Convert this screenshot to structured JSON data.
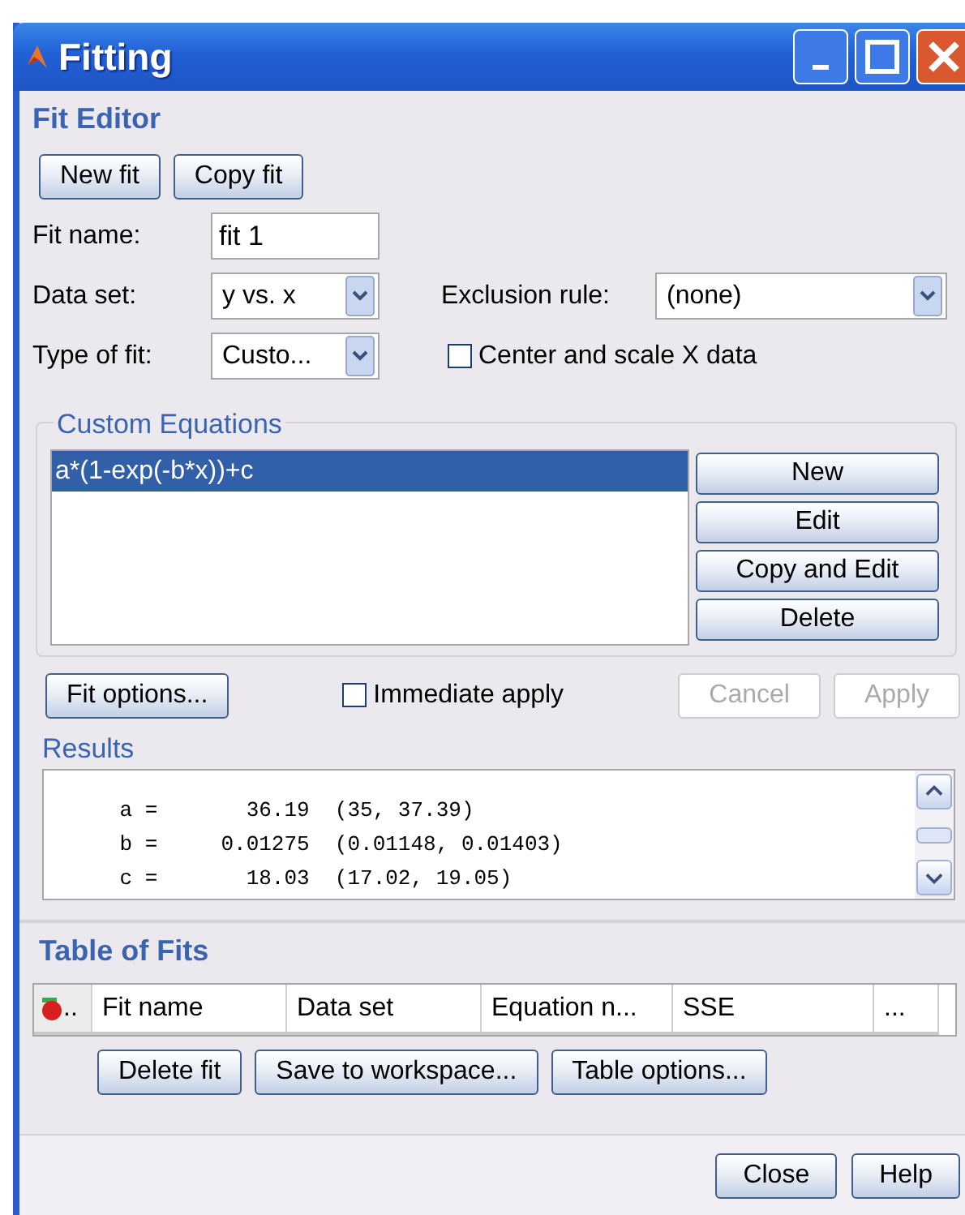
{
  "window": {
    "title": "Fitting"
  },
  "fit_editor": {
    "title": "Fit Editor",
    "top_buttons": [
      {
        "label": "New fit",
        "disabled": false
      },
      {
        "label": "Copy fit",
        "disabled": false
      }
    ],
    "fit_name": {
      "label": "Fit name:",
      "value": "fit 1"
    },
    "data_set": {
      "label": "Data set:",
      "value": "y vs. x"
    },
    "exclusion_rule": {
      "label": "Exclusion rule:",
      "value": "(none)"
    },
    "type_of_fit": {
      "label": "Type of fit:",
      "value": "Custo..."
    },
    "center_scale": {
      "label": "Center and scale X data",
      "checked": false
    }
  },
  "custom_equations": {
    "title": "Custom Equations",
    "items": [
      {
        "label": "a*(1-exp(-b*x))+c",
        "selected": true
      }
    ],
    "buttons": [
      {
        "label": "New",
        "disabled": false
      },
      {
        "label": "Edit",
        "disabled": false
      },
      {
        "label": "Copy and Edit",
        "disabled": false
      },
      {
        "label": "Delete",
        "disabled": false
      }
    ]
  },
  "options_row": {
    "fit_options": {
      "label": "Fit options...",
      "disabled": false
    },
    "immediate_apply": {
      "label": "Immediate apply",
      "checked": false
    },
    "buttons": [
      {
        "label": "Cancel",
        "disabled": true
      },
      {
        "label": "Apply",
        "disabled": true
      }
    ]
  },
  "results": {
    "title": "Results",
    "lines": [
      "      a =       36.19  (35, 37.39)",
      "      b =     0.01275  (0.01148, 0.01403)",
      "      c =       18.03  (17.02, 19.05)"
    ]
  },
  "table_of_fits": {
    "title": "Table of Fits",
    "columns": [
      "..",
      "Fit name",
      "Data set",
      "Equation n...",
      "SSE",
      "..."
    ],
    "buttons": [
      {
        "label": "Delete fit",
        "disabled": false
      },
      {
        "label": "Save to workspace...",
        "disabled": false
      },
      {
        "label": "Table options...",
        "disabled": false
      }
    ]
  },
  "footer_buttons": [
    {
      "label": "Close",
      "disabled": false
    },
    {
      "label": "Help",
      "disabled": false
    }
  ]
}
